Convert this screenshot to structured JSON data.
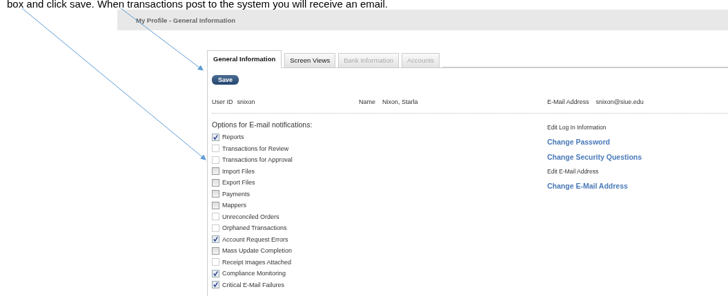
{
  "caption": "box and click save.  When transactions post to the system you will receive an email.",
  "header": {
    "title": "My Profile - General Information"
  },
  "tabs": [
    {
      "label": "General Information",
      "selected": true,
      "disabled": false
    },
    {
      "label": "Screen Views",
      "selected": false,
      "disabled": false
    },
    {
      "label": "Bank Information",
      "selected": false,
      "disabled": true
    },
    {
      "label": "Accounts",
      "selected": false,
      "disabled": true
    }
  ],
  "save_button": "Save",
  "user": {
    "user_id_label": "User ID",
    "user_id": "snixon",
    "name_label": "Name",
    "name": "Nixon, Starla",
    "email_label": "E-Mail Address",
    "email": "snixon@siue.edu"
  },
  "notifications": {
    "title": "Options for E-mail notifications:",
    "options": [
      {
        "label": "Reports",
        "checked": true,
        "disabled": false
      },
      {
        "label": "Transactions for Review",
        "checked": false,
        "disabled": true
      },
      {
        "label": "Transactions for Approval",
        "checked": false,
        "disabled": true
      },
      {
        "label": "Import Files",
        "checked": false,
        "disabled": false
      },
      {
        "label": "Export Files",
        "checked": false,
        "disabled": false
      },
      {
        "label": "Payments",
        "checked": false,
        "disabled": false
      },
      {
        "label": "Mappers",
        "checked": false,
        "disabled": false
      },
      {
        "label": "Unreconciled Orders",
        "checked": false,
        "disabled": true
      },
      {
        "label": "Orphaned Transactions",
        "checked": false,
        "disabled": true
      },
      {
        "label": "Account Request Errors",
        "checked": true,
        "disabled": false
      },
      {
        "label": "Mass Update Completion",
        "checked": false,
        "disabled": false
      },
      {
        "label": "Receipt Images Attached",
        "checked": false,
        "disabled": true
      },
      {
        "label": "Compliance Monitoring",
        "checked": true,
        "disabled": false
      },
      {
        "label": "Critical E-Mail Failures",
        "checked": true,
        "disabled": false
      }
    ]
  },
  "side": [
    {
      "kind": "heading",
      "label": "Edit Log In Information"
    },
    {
      "kind": "link",
      "label": "Change Password"
    },
    {
      "kind": "link",
      "label": "Change Security Questions"
    },
    {
      "kind": "heading",
      "label": "Edit E-Mail Address"
    },
    {
      "kind": "link",
      "label": "Change E-Mail Address"
    }
  ]
}
